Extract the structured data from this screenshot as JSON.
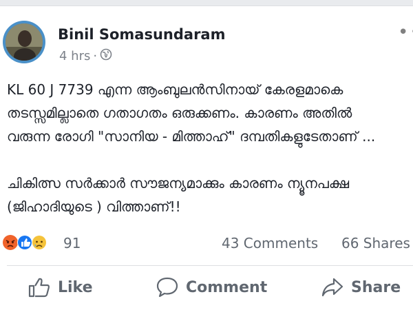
{
  "post": {
    "author": "Binil Somasundaram",
    "time": "4 hrs",
    "separator": "·",
    "audience_icon": "globe-icon",
    "body_lines": [
      "KL 60 J 7739 എന്ന ആംബുലൻസിനായ് കേരളമാകെ",
      "തടസ്സമില്ലാതെ ഗതാഗതം ഒരുക്കണം. കാരണം അതിൽ",
      "വരുന്ന രോഗി \"സാനിയ - മിത്താഹ്\" ദമ്പതികളുടേതാണ് ...",
      "ചികിത്സ സർക്കാർ സൗജന്യമാക്കും കാരണം ന്യൂനപക്ഷ",
      "(ജിഹാദിയുടെ ) വിത്താണ്!!"
    ]
  },
  "reactions": {
    "icons": [
      "angry-icon",
      "like-icon",
      "sad-icon"
    ],
    "count": "91",
    "comments": "43 Comments",
    "shares": "66 Shares"
  },
  "actions": {
    "like": "Like",
    "comment": "Comment",
    "share": "Share"
  },
  "colors": {
    "angry": "#f0632b",
    "like": "#1877f2",
    "sad": "#f5c33b",
    "secondary_text": "#606770",
    "divider": "#dddfe2"
  }
}
